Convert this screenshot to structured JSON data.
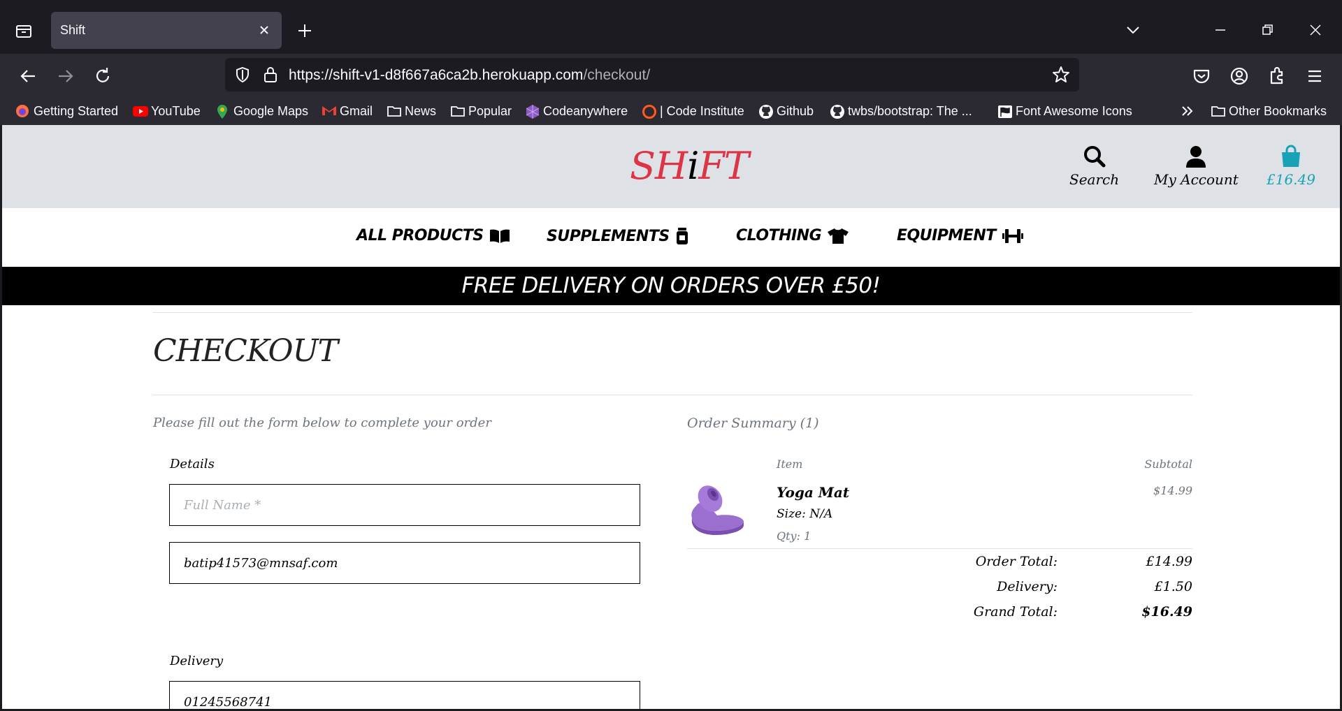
{
  "browser": {
    "tab_title": "Shift",
    "url_host": "https://shift-v1-d8f667a6ca2b.herokuapp.com",
    "url_path": "/checkout/",
    "bookmarks": [
      {
        "label": "Getting Started",
        "icon": "firefox-icon"
      },
      {
        "label": "YouTube",
        "icon": "youtube-icon"
      },
      {
        "label": "Google Maps",
        "icon": "google-maps-icon"
      },
      {
        "label": "Gmail",
        "icon": "gmail-icon"
      },
      {
        "label": "News",
        "icon": "folder-icon"
      },
      {
        "label": "Popular",
        "icon": "folder-icon"
      },
      {
        "label": "Codeanywhere",
        "icon": "codeanywhere-icon"
      },
      {
        "label": "| Code Institute",
        "icon": "code-institute-icon"
      },
      {
        "label": "Github",
        "icon": "github-icon"
      },
      {
        "label": "twbs/bootstrap: The ...",
        "icon": "github-icon"
      },
      {
        "label": "Font Awesome Icons",
        "icon": "flag-icon"
      }
    ],
    "other_bookmarks": "Other Bookmarks"
  },
  "site": {
    "logo_pre": "SH",
    "logo_i": "i",
    "logo_post": "FT",
    "header": {
      "search": "Search",
      "account": "My Account",
      "cart_total": "£16.49"
    },
    "nav": [
      {
        "label": "ALL PRODUCTS",
        "icon": "book-open-icon"
      },
      {
        "label": "SUPPLEMENTS",
        "icon": "jar-icon"
      },
      {
        "label": "CLOTHING",
        "icon": "tshirt-icon"
      },
      {
        "label": "EQUIPMENT",
        "icon": "dumbbell-icon"
      }
    ],
    "banner": "FREE DELIVERY ON ORDERS OVER £50!"
  },
  "checkout": {
    "title": "CHECKOUT",
    "form_intro": "Please fill out the form below to complete your order",
    "details_legend": "Details",
    "full_name_placeholder": "Full Name *",
    "full_name_value": "",
    "email_value": "batip41573@mnsaf.com",
    "delivery_legend": "Delivery",
    "phone_value": "01245568741"
  },
  "summary": {
    "title": "Order Summary (1)",
    "col_item": "Item",
    "col_subtotal": "Subtotal",
    "product": {
      "name": "Yoga Mat",
      "size": "Size: N/A",
      "qty": "Qty: 1",
      "price": "$14.99"
    },
    "order_total_label": "Order Total:",
    "order_total": "£14.99",
    "delivery_label": "Delivery:",
    "delivery": "£1.50",
    "grand_total_label": "Grand Total:",
    "grand_total": "$16.49"
  }
}
